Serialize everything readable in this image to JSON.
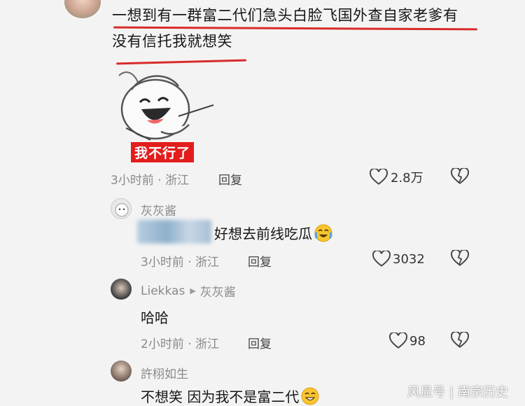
{
  "comments": [
    {
      "text_line1": "一想到有一群富二代们急头白脸飞国外查自家老爹有",
      "text_line2": "没有信托我就想笑",
      "sticker_label": "我不行了",
      "time_location": "3小时前 · 浙江",
      "reply_label": "回复",
      "likes": "2.8万"
    }
  ],
  "replies": [
    {
      "username": "灰灰酱",
      "text": "好想去前线吃瓜",
      "time_location": "3小时前 · 浙江",
      "reply_label": "回复",
      "likes": "3032"
    },
    {
      "username": "Liekkas",
      "reply_to": "灰灰酱",
      "text": "哈哈",
      "time_location": "2小时前 · 浙江",
      "reply_label": "回复",
      "likes": "98"
    },
    {
      "username": "許栩如生",
      "text": "不想笑 因为我不是富二代"
    }
  ],
  "watermark": {
    "left": "风显号",
    "right": "南宗历史"
  },
  "colors": {
    "underline": "#d92b2b",
    "sticker_badge": "#e31c1c",
    "meta_text": "#8a8a8a"
  },
  "icons": [
    "heart-icon",
    "dislike-heart-icon",
    "crying-laugh-emoji",
    "grin-sweat-emoji",
    "play-triangle-icon"
  ]
}
